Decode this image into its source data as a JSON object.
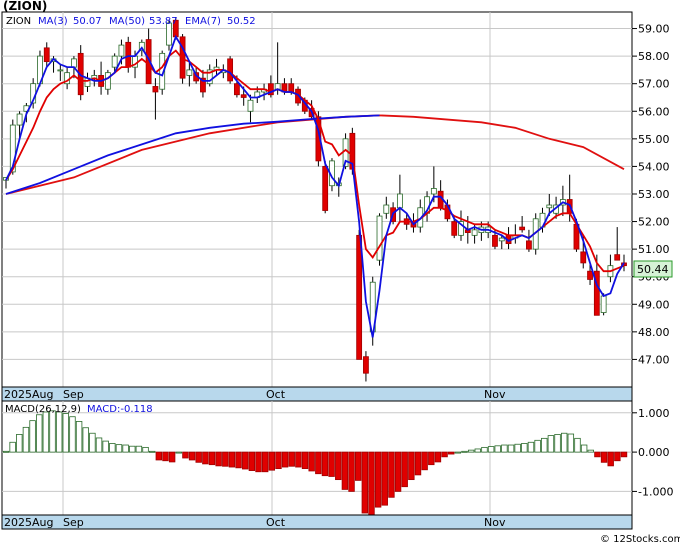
{
  "title": "(ZION)",
  "watermark": "© 12Stocks.com",
  "legend": {
    "symbol": "ZION",
    "ma3_label": "MA(3)",
    "ma3_value": "50.07",
    "ma50_label": "MA(50)",
    "ma50_value": "53.87",
    "ema7_label": "EMA(7)",
    "ema7_value": "50.52"
  },
  "last_price_label": "50.44",
  "macd_legend": {
    "label": "MACD(26,12,9)",
    "value_label": "MACD:-0.118"
  },
  "x_axis_labels": [
    "2025Aug",
    "Sep",
    "Oct",
    "Nov"
  ],
  "colors": {
    "up": "#ffffff",
    "down": "#e00000",
    "ma3": "#1010e0",
    "ema7": "#e00000",
    "ma50_line": "#e01010",
    "ma_blue": "#1010e0",
    "axis_band": "#b8d8ec",
    "grid": "#c8c8c8",
    "macd_up": "#ffffff",
    "macd_down": "#e00000"
  },
  "chart_data": [
    {
      "type": "candlestick",
      "ylim": [
        46.0,
        59.6
      ],
      "y_ticks": [
        "47.00",
        "48.00",
        "49.00",
        "50.00",
        "51.00",
        "52.00",
        "53.00",
        "54.00",
        "55.00",
        "56.00",
        "57.00",
        "58.00",
        "59.00"
      ],
      "grid": true,
      "candles": [
        [
          53.5,
          53.6,
          53.2,
          53.6
        ],
        [
          53.8,
          55.7,
          53.7,
          55.5
        ],
        [
          55.5,
          56.0,
          55.0,
          55.9
        ],
        [
          56.0,
          56.3,
          55.6,
          56.2
        ],
        [
          56.3,
          57.2,
          56.1,
          57.0
        ],
        [
          57.0,
          58.2,
          56.9,
          58.0
        ],
        [
          58.3,
          58.5,
          57.6,
          57.8
        ],
        [
          57.8,
          58.0,
          57.4,
          57.9
        ],
        [
          57.5,
          57.7,
          57.1,
          57.5
        ],
        [
          57.0,
          57.6,
          56.8,
          57.4
        ],
        [
          57.6,
          58.0,
          57.2,
          57.9
        ],
        [
          58.1,
          58.4,
          56.4,
          56.6
        ],
        [
          56.9,
          57.4,
          56.7,
          57.2
        ],
        [
          57.2,
          57.5,
          56.9,
          57.3
        ],
        [
          57.3,
          57.8,
          56.6,
          56.9
        ],
        [
          56.8,
          57.5,
          56.6,
          57.4
        ],
        [
          57.6,
          58.1,
          57.4,
          58.0
        ],
        [
          58.0,
          58.6,
          57.7,
          58.4
        ],
        [
          58.5,
          58.7,
          57.4,
          57.6
        ],
        [
          57.6,
          58.2,
          57.2,
          58.0
        ],
        [
          58.2,
          58.6,
          58.0,
          58.5
        ],
        [
          58.6,
          59.0,
          57.0,
          57.0
        ],
        [
          56.9,
          57.2,
          55.7,
          56.7
        ],
        [
          56.8,
          58.2,
          56.6,
          58.1
        ],
        [
          58.4,
          59.3,
          58.2,
          59.2
        ],
        [
          59.3,
          59.4,
          58.6,
          58.7
        ],
        [
          58.7,
          58.8,
          57.0,
          57.2
        ],
        [
          57.3,
          57.8,
          56.9,
          57.5
        ],
        [
          57.4,
          57.6,
          57.0,
          57.1
        ],
        [
          57.2,
          57.5,
          56.5,
          56.7
        ],
        [
          57.0,
          57.7,
          56.9,
          57.5
        ],
        [
          57.5,
          57.9,
          57.3,
          57.6
        ],
        [
          57.4,
          57.7,
          57.2,
          57.5
        ],
        [
          57.9,
          58.0,
          57.0,
          57.1
        ],
        [
          57.0,
          57.3,
          56.5,
          56.6
        ],
        [
          56.6,
          56.9,
          56.2,
          56.5
        ],
        [
          56.0,
          56.6,
          55.6,
          56.4
        ],
        [
          56.5,
          56.9,
          56.3,
          56.7
        ],
        [
          56.7,
          57.0,
          56.4,
          56.8
        ],
        [
          57.0,
          57.3,
          56.5,
          56.6
        ],
        [
          56.8,
          58.5,
          56.6,
          57.0
        ],
        [
          57.0,
          57.2,
          56.6,
          56.7
        ],
        [
          57.0,
          57.2,
          56.6,
          56.7
        ],
        [
          56.8,
          56.9,
          56.2,
          56.3
        ],
        [
          56.4,
          56.5,
          55.9,
          56.0
        ],
        [
          56.1,
          56.4,
          55.7,
          55.8
        ],
        [
          55.8,
          56.0,
          54.0,
          54.2
        ],
        [
          54.0,
          54.2,
          52.3,
          52.4
        ],
        [
          53.3,
          54.3,
          53.1,
          54.2
        ],
        [
          53.3,
          53.6,
          52.9,
          53.4
        ],
        [
          54.0,
          55.2,
          53.9,
          55.0
        ],
        [
          55.2,
          55.4,
          53.7,
          53.9
        ],
        [
          51.5,
          51.7,
          47.2,
          47.0
        ],
        [
          47.1,
          47.3,
          46.2,
          46.5
        ],
        [
          48.0,
          50.0,
          47.5,
          49.8
        ],
        [
          50.6,
          52.3,
          50.4,
          52.2
        ],
        [
          52.3,
          52.9,
          52.1,
          52.6
        ],
        [
          52.5,
          52.7,
          51.9,
          52.0
        ],
        [
          52.5,
          53.7,
          52.0,
          53.0
        ],
        [
          52.1,
          52.3,
          51.7,
          51.9
        ],
        [
          52.0,
          52.3,
          51.6,
          51.8
        ],
        [
          51.8,
          52.8,
          51.6,
          52.5
        ],
        [
          52.3,
          53.1,
          52.0,
          52.9
        ],
        [
          53.0,
          54.0,
          52.7,
          53.2
        ],
        [
          53.1,
          53.5,
          52.4,
          52.5
        ],
        [
          52.6,
          52.8,
          52.0,
          52.1
        ],
        [
          52.0,
          52.2,
          51.4,
          51.5
        ],
        [
          51.5,
          52.4,
          51.3,
          52.0
        ],
        [
          51.7,
          52.2,
          51.2,
          51.6
        ],
        [
          51.5,
          51.9,
          51.2,
          51.7
        ],
        [
          51.6,
          52.0,
          51.3,
          51.8
        ],
        [
          51.6,
          52.0,
          51.4,
          51.8
        ],
        [
          51.5,
          51.7,
          51.0,
          51.1
        ],
        [
          51.3,
          51.5,
          51.0,
          51.4
        ],
        [
          51.5,
          51.8,
          51.0,
          51.2
        ],
        [
          51.4,
          51.9,
          51.2,
          51.5
        ],
        [
          51.8,
          52.2,
          51.6,
          51.7
        ],
        [
          51.3,
          51.7,
          50.9,
          51.0
        ],
        [
          51.0,
          52.3,
          50.8,
          52.1
        ],
        [
          51.8,
          52.5,
          51.6,
          52.3
        ],
        [
          52.5,
          53.0,
          52.2,
          52.6
        ],
        [
          52.3,
          52.9,
          52.1,
          52.6
        ],
        [
          52.6,
          53.3,
          52.2,
          52.8
        ],
        [
          52.8,
          53.7,
          52.0,
          52.3
        ],
        [
          51.9,
          52.1,
          50.9,
          51.0
        ],
        [
          50.9,
          51.5,
          50.3,
          50.5
        ],
        [
          50.2,
          50.5,
          49.7,
          49.9
        ],
        [
          50.2,
          50.8,
          48.7,
          48.6
        ],
        [
          48.7,
          49.4,
          48.6,
          49.3
        ],
        [
          50.0,
          50.8,
          49.8,
          50.4
        ],
        [
          50.8,
          51.8,
          50.6,
          50.6
        ],
        [
          50.5,
          50.8,
          50.2,
          50.4
        ]
      ],
      "ma3": [
        53.5,
        54.0,
        55.0,
        55.9,
        56.4,
        57.0,
        57.6,
        57.9,
        57.7,
        57.6,
        57.6,
        57.3,
        57.2,
        57.1,
        57.1,
        57.2,
        57.4,
        57.9,
        58.0,
        58.0,
        58.3,
        57.9,
        57.4,
        57.3,
        58.0,
        58.7,
        58.3,
        57.8,
        57.3,
        57.1,
        57.1,
        57.3,
        57.5,
        57.4,
        57.1,
        56.8,
        56.5,
        56.5,
        56.6,
        56.7,
        56.8,
        56.7,
        56.7,
        56.6,
        56.3,
        56.0,
        55.3,
        54.1,
        53.6,
        53.3,
        54.2,
        54.1,
        52.0,
        49.1,
        47.8,
        49.5,
        51.5,
        52.3,
        52.5,
        52.3,
        51.9,
        52.1,
        52.4,
        52.9,
        52.9,
        52.6,
        52.1,
        51.9,
        51.7,
        51.8,
        51.7,
        51.7,
        51.6,
        51.5,
        51.3,
        51.4,
        51.5,
        51.4,
        51.6,
        51.8,
        52.3,
        52.5,
        52.7,
        52.6,
        52.0,
        51.3,
        50.5,
        49.7,
        49.3,
        49.4,
        50.1,
        50.5
      ],
      "ema7": [
        53.5,
        53.9,
        54.4,
        54.9,
        55.4,
        56.0,
        56.5,
        56.8,
        57.0,
        57.1,
        57.3,
        57.1,
        57.1,
        57.2,
        57.1,
        57.2,
        57.4,
        57.6,
        57.6,
        57.7,
        57.9,
        57.7,
        57.4,
        57.6,
        58.0,
        58.2,
        57.9,
        57.8,
        57.6,
        57.4,
        57.4,
        57.5,
        57.5,
        57.4,
        57.2,
        57.0,
        56.8,
        56.8,
        56.8,
        56.7,
        56.8,
        56.7,
        56.7,
        56.6,
        56.4,
        56.2,
        55.7,
        54.9,
        54.8,
        54.4,
        54.6,
        54.4,
        52.6,
        51.0,
        50.7,
        51.1,
        51.5,
        51.6,
        52.0,
        52.0,
        52.0,
        52.1,
        52.3,
        52.5,
        52.5,
        52.4,
        52.2,
        52.1,
        52.0,
        51.9,
        51.9,
        51.9,
        51.7,
        51.6,
        51.5,
        51.5,
        51.5,
        51.4,
        51.6,
        51.8,
        52.0,
        52.2,
        52.3,
        52.3,
        51.9,
        51.5,
        51.1,
        50.5,
        50.2,
        50.2,
        50.3,
        50.4
      ],
      "ma50_points": [
        [
          0,
          53.0
        ],
        [
          10,
          53.6
        ],
        [
          20,
          54.6
        ],
        [
          30,
          55.2
        ],
        [
          40,
          55.6
        ],
        [
          50,
          55.8
        ],
        [
          55,
          55.85
        ],
        [
          60,
          55.8
        ],
        [
          70,
          55.6
        ],
        [
          75,
          55.4
        ],
        [
          80,
          55.0
        ],
        [
          85,
          54.7
        ],
        [
          91,
          53.9
        ]
      ],
      "ma_blue_long_points": [
        [
          0,
          53.0
        ],
        [
          5,
          53.4
        ],
        [
          10,
          53.9
        ],
        [
          15,
          54.4
        ],
        [
          20,
          54.8
        ],
        [
          25,
          55.2
        ],
        [
          30,
          55.4
        ],
        [
          35,
          55.55
        ],
        [
          40,
          55.62
        ],
        [
          45,
          55.72
        ],
        [
          50,
          55.8
        ],
        [
          55,
          55.85
        ]
      ]
    },
    {
      "type": "macd_histogram",
      "ylim": [
        -1.6,
        1.3
      ],
      "y_ticks": [
        "1.000",
        "0.000",
        "-1.000"
      ],
      "values": [
        0.02,
        0.25,
        0.45,
        0.63,
        0.8,
        0.95,
        1.02,
        1.05,
        1.02,
        0.98,
        0.9,
        0.78,
        0.62,
        0.48,
        0.36,
        0.28,
        0.22,
        0.19,
        0.18,
        0.15,
        0.15,
        0.12,
        0.02,
        -0.2,
        -0.22,
        -0.25,
        0.0,
        -0.15,
        -0.2,
        -0.26,
        -0.3,
        -0.32,
        -0.35,
        -0.36,
        -0.38,
        -0.4,
        -0.43,
        -0.47,
        -0.5,
        -0.5,
        -0.46,
        -0.42,
        -0.38,
        -0.36,
        -0.38,
        -0.42,
        -0.48,
        -0.55,
        -0.6,
        -0.62,
        -0.7,
        -0.95,
        -1.0,
        -0.72,
        -1.55,
        -1.65,
        -1.4,
        -1.35,
        -1.15,
        -1.0,
        -0.88,
        -0.7,
        -0.58,
        -0.45,
        -0.32,
        -0.25,
        -0.12,
        -0.05,
        0.0,
        0.02,
        0.05,
        0.08,
        0.12,
        0.14,
        0.16,
        0.18,
        0.18,
        0.2,
        0.22,
        0.25,
        0.3,
        0.35,
        0.42,
        0.45,
        0.48,
        0.46,
        0.35,
        0.18,
        0.05,
        -0.12,
        -0.26,
        -0.35,
        -0.22,
        -0.12
      ]
    }
  ]
}
